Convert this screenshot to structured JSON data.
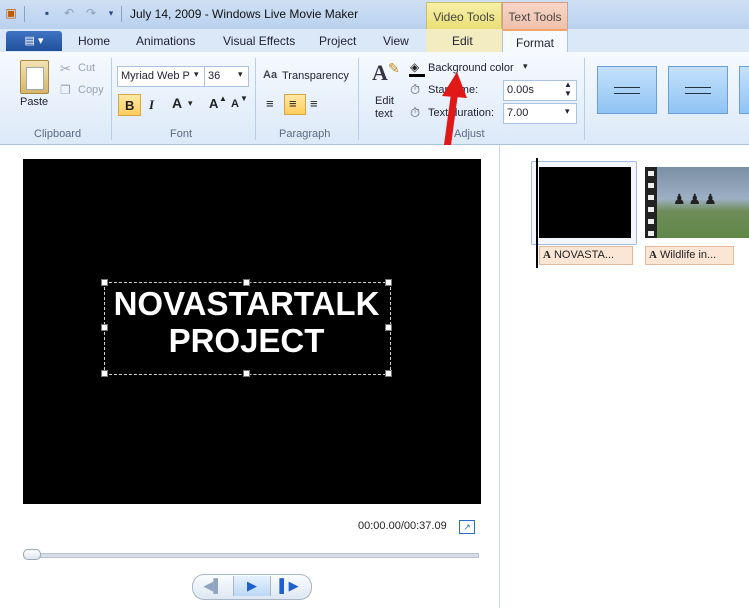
{
  "window": {
    "title": "July 14, 2009 - Windows Live Movie Maker"
  },
  "context_tabs": {
    "video_tools": "Video Tools",
    "text_tools": "Text Tools"
  },
  "tabs": {
    "home": "Home",
    "animations": "Animations",
    "visual_effects": "Visual Effects",
    "project": "Project",
    "view": "View",
    "edit": "Edit",
    "format": "Format"
  },
  "clipboard": {
    "paste": "Paste",
    "cut": "Cut",
    "copy": "Copy",
    "label": "Clipboard"
  },
  "font": {
    "family": "Myriad Web P",
    "size": "36",
    "bold": "B",
    "italic": "I",
    "color": "A",
    "grow": "A",
    "shrink": "A",
    "label": "Font"
  },
  "paragraph": {
    "transparency": "Transparency",
    "label": "Paragraph"
  },
  "adjust": {
    "edit_text_line1": "Edit",
    "edit_text_line2": "text",
    "background_color": "Background color",
    "start_time_label": "Start time:",
    "start_time_value": "0.00s",
    "text_duration_label": "Text duration:",
    "text_duration_value": "7.00",
    "label": "Adjust"
  },
  "preview": {
    "title_line1": "NOVASTARTALK",
    "title_line2": "PROJECT",
    "timecode": "00:00.00/00:37.09"
  },
  "storyboard": {
    "clip1_caption": "NOVASTA...",
    "clip2_caption": "Wildlife in..."
  },
  "colors": {
    "accent": "#1f4f9b",
    "annotation_arrow": "#e01818",
    "video_tools": "#e9dd72",
    "text_tools": "#eebfa9"
  }
}
